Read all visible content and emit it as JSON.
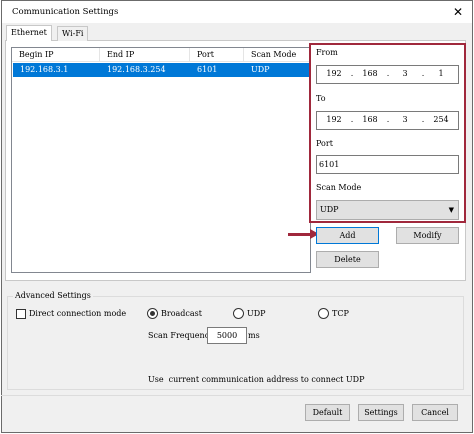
{
  "window": {
    "title": "Communication Settings",
    "close_glyph": "✕"
  },
  "tabs": [
    {
      "label": "Ethernet",
      "active": true
    },
    {
      "label": "Wi-Fi",
      "active": false
    }
  ],
  "table": {
    "columns": [
      "Begin IP",
      "End IP",
      "Port",
      "Scan Mode"
    ],
    "rows": [
      {
        "begin_ip": "192.168.3.1",
        "end_ip": "192.168.3.254",
        "port": "6101",
        "scan_mode": "UDP",
        "selected": true
      }
    ]
  },
  "form": {
    "from_label": "From",
    "from_ip": [
      "192",
      "168",
      "3",
      "1"
    ],
    "to_label": "To",
    "to_ip": [
      "192",
      "168",
      "3",
      "254"
    ],
    "ip_dot": ".",
    "port_label": "Port",
    "port_value": "6101",
    "scan_mode_label": "Scan Mode",
    "scan_mode_value": "UDP",
    "combo_arrow": "▼"
  },
  "buttons": {
    "add": "Add",
    "modify": "Modify",
    "delete": "Delete",
    "default": "Default",
    "settings": "Settings",
    "cancel": "Cancel"
  },
  "advanced": {
    "legend": "Advanced Settings",
    "direct_mode_label": "Direct connection mode",
    "direct_mode_checked": false,
    "radios": [
      {
        "label": "Broadcast",
        "checked": true
      },
      {
        "label": "UDP",
        "checked": false
      },
      {
        "label": "TCP",
        "checked": false
      }
    ],
    "scan_frequency_label": "Scan Frequency",
    "scan_frequency_value": "5000",
    "scan_frequency_unit": "ms",
    "hint": "Use  current communication address to connect UDP"
  },
  "colors": {
    "highlight": "#a0283c",
    "selection": "#0078d7"
  }
}
